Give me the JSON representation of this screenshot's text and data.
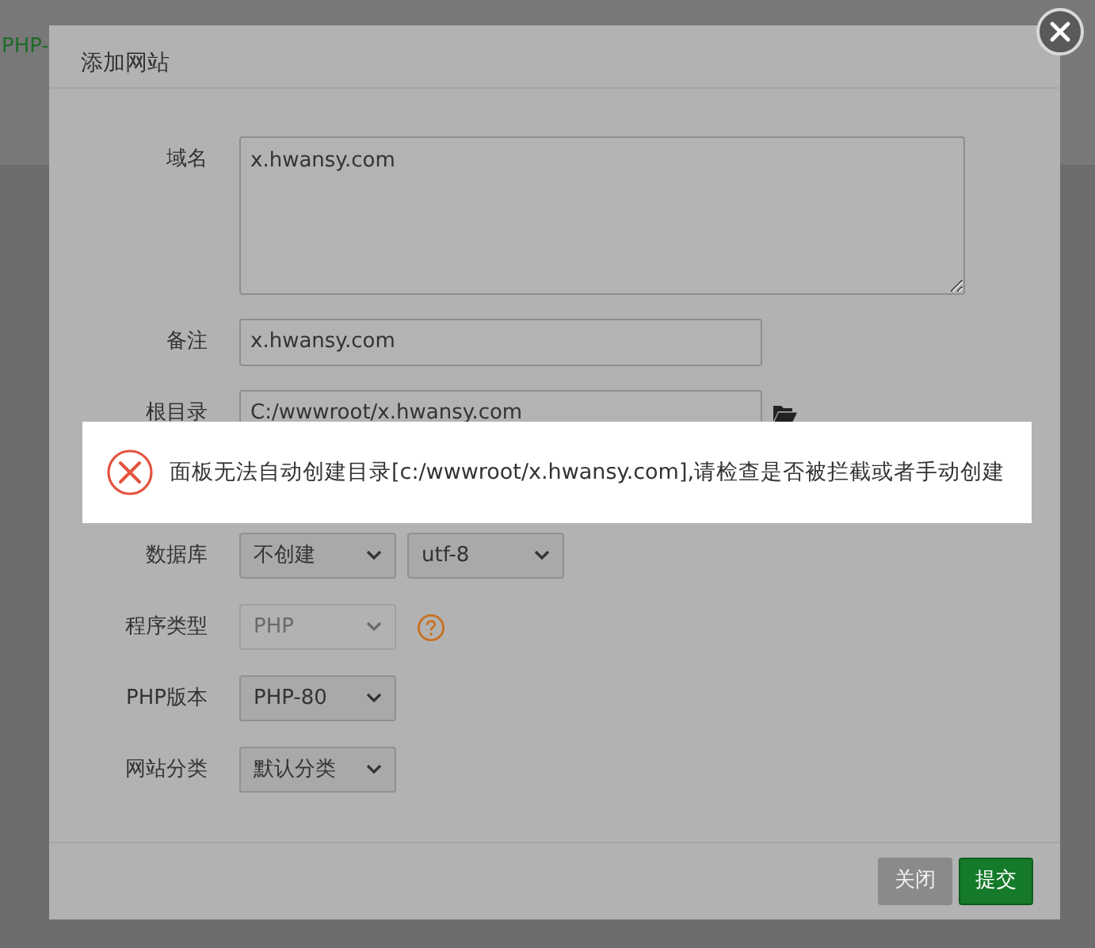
{
  "background": {
    "tab_text": "PHP-"
  },
  "dialog": {
    "title": "添加网站"
  },
  "fields": [
    {
      "kind": "textarea",
      "label": "域名",
      "value": "x.hwansy.com"
    },
    {
      "kind": "input",
      "label": "备注",
      "value": "x.hwansy.com"
    },
    {
      "kind": "folder_input",
      "label": "根目录",
      "value": "C:/wwwroot/x.hwansy.com"
    },
    {
      "kind": "select",
      "label": "数据库",
      "selects": [
        {
          "value": "不创建",
          "disabled": false
        },
        {
          "value": "utf-8",
          "disabled": false
        }
      ]
    },
    {
      "kind": "select",
      "label": "程序类型",
      "selects": [
        {
          "value": "PHP",
          "disabled": true
        }
      ],
      "help": true
    },
    {
      "kind": "select",
      "label": "PHP版本",
      "selects": [
        {
          "value": "PHP-80",
          "disabled": false
        }
      ]
    },
    {
      "kind": "select",
      "label": "网站分类",
      "selects": [
        {
          "value": "默认分类",
          "disabled": false
        }
      ]
    }
  ],
  "buttons": [
    {
      "label": "关闭",
      "kind": "secondary"
    },
    {
      "label": "提交",
      "kind": "primary"
    }
  ],
  "toast": {
    "kind": "error",
    "message": "面板无法自动创建目录[c:/wwwroot/x.hwansy.com],请检查是否被拦截或者手动创建"
  }
}
